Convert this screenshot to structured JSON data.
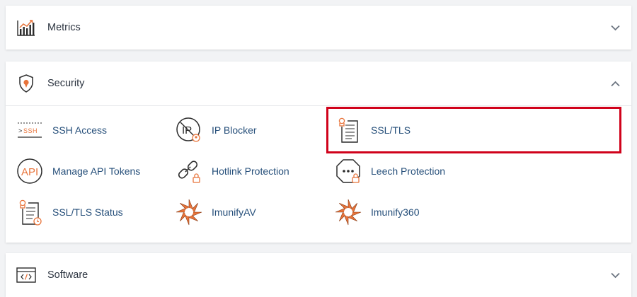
{
  "colors": {
    "accent": "#e8743b",
    "link": "#264f7a",
    "highlight": "#d0021b",
    "icon_stroke": "#2b2b2b"
  },
  "metrics": {
    "title": "Metrics",
    "icon": "bar-chart-icon",
    "state": "collapsed"
  },
  "security": {
    "title": "Security",
    "icon": "shield-icon",
    "state": "expanded",
    "items": [
      {
        "label": "SSH Access",
        "icon": "ssh-terminal-icon"
      },
      {
        "label": "IP Blocker",
        "icon": "ip-blocker-icon"
      },
      {
        "label": "SSL/TLS",
        "icon": "certificate-icon",
        "highlighted": true
      },
      {
        "label": "Manage API Tokens",
        "icon": "api-icon"
      },
      {
        "label": "Hotlink Protection",
        "icon": "hotlink-chain-icon"
      },
      {
        "label": "Leech Protection",
        "icon": "leech-octagon-icon"
      },
      {
        "label": "SSL/TLS Status",
        "icon": "certificate-status-icon"
      },
      {
        "label": "ImunifyAV",
        "icon": "imunify-star-icon"
      },
      {
        "label": "Imunify360",
        "icon": "imunify360-star-icon"
      }
    ]
  },
  "software": {
    "title": "Software",
    "icon": "code-window-icon",
    "state": "collapsed"
  }
}
